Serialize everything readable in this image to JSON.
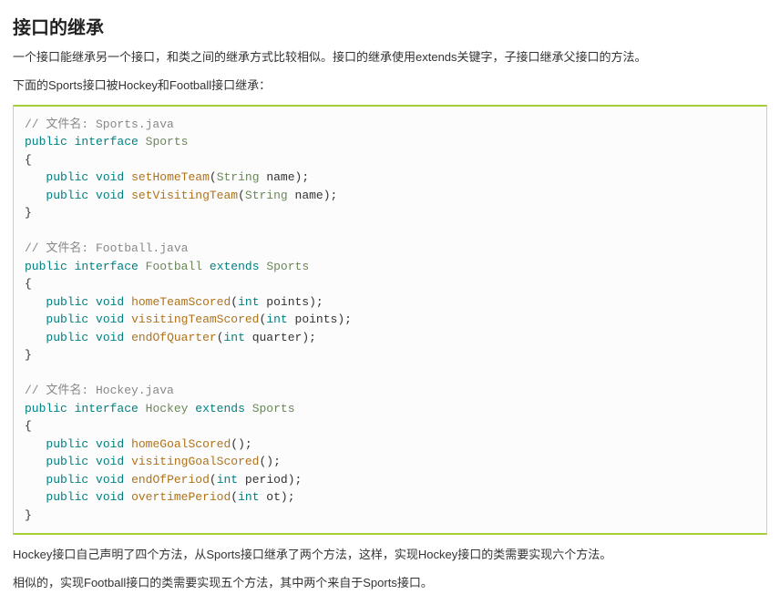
{
  "heading": "接口的继承",
  "para1": "一个接口能继承另一个接口，和类之间的继承方式比较相似。接口的继承使用extends关键字，子接口继承父接口的方法。",
  "para2": "下面的Sports接口被Hockey和Football接口继承：",
  "para3": "Hockey接口自己声明了四个方法，从Sports接口继承了两个方法，这样，实现Hockey接口的类需要实现六个方法。",
  "para4": "相似的，实现Football接口的类需要实现五个方法，其中两个来自于Sports接口。",
  "code": {
    "lines": [
      {
        "seg": [
          {
            "c": "com",
            "t": "// 文件名: Sports.java"
          }
        ]
      },
      {
        "seg": [
          {
            "c": "kw",
            "t": "public"
          },
          {
            "c": "pun",
            "t": " "
          },
          {
            "c": "kw",
            "t": "interface"
          },
          {
            "c": "pun",
            "t": " "
          },
          {
            "c": "typ",
            "t": "Sports"
          }
        ]
      },
      {
        "seg": [
          {
            "c": "pun",
            "t": "{"
          }
        ]
      },
      {
        "seg": [
          {
            "c": "pun",
            "t": "   "
          },
          {
            "c": "kw",
            "t": "public"
          },
          {
            "c": "pun",
            "t": " "
          },
          {
            "c": "kw",
            "t": "void"
          },
          {
            "c": "pun",
            "t": " "
          },
          {
            "c": "fn",
            "t": "setHomeTeam"
          },
          {
            "c": "pun",
            "t": "("
          },
          {
            "c": "typ",
            "t": "String"
          },
          {
            "c": "pun",
            "t": " name);"
          }
        ]
      },
      {
        "seg": [
          {
            "c": "pun",
            "t": "   "
          },
          {
            "c": "kw",
            "t": "public"
          },
          {
            "c": "pun",
            "t": " "
          },
          {
            "c": "kw",
            "t": "void"
          },
          {
            "c": "pun",
            "t": " "
          },
          {
            "c": "fn",
            "t": "setVisitingTeam"
          },
          {
            "c": "pun",
            "t": "("
          },
          {
            "c": "typ",
            "t": "String"
          },
          {
            "c": "pun",
            "t": " name);"
          }
        ]
      },
      {
        "seg": [
          {
            "c": "pun",
            "t": "}"
          }
        ]
      },
      {
        "seg": [
          {
            "c": "pun",
            "t": " "
          }
        ]
      },
      {
        "seg": [
          {
            "c": "com",
            "t": "// 文件名: Football.java"
          }
        ]
      },
      {
        "seg": [
          {
            "c": "kw",
            "t": "public"
          },
          {
            "c": "pun",
            "t": " "
          },
          {
            "c": "kw",
            "t": "interface"
          },
          {
            "c": "pun",
            "t": " "
          },
          {
            "c": "typ",
            "t": "Football"
          },
          {
            "c": "pun",
            "t": " "
          },
          {
            "c": "kw",
            "t": "extends"
          },
          {
            "c": "pun",
            "t": " "
          },
          {
            "c": "typ",
            "t": "Sports"
          }
        ]
      },
      {
        "seg": [
          {
            "c": "pun",
            "t": "{"
          }
        ]
      },
      {
        "seg": [
          {
            "c": "pun",
            "t": "   "
          },
          {
            "c": "kw",
            "t": "public"
          },
          {
            "c": "pun",
            "t": " "
          },
          {
            "c": "kw",
            "t": "void"
          },
          {
            "c": "pun",
            "t": " "
          },
          {
            "c": "fn",
            "t": "homeTeamScored"
          },
          {
            "c": "pun",
            "t": "("
          },
          {
            "c": "kw",
            "t": "int"
          },
          {
            "c": "pun",
            "t": " points);"
          }
        ]
      },
      {
        "seg": [
          {
            "c": "pun",
            "t": "   "
          },
          {
            "c": "kw",
            "t": "public"
          },
          {
            "c": "pun",
            "t": " "
          },
          {
            "c": "kw",
            "t": "void"
          },
          {
            "c": "pun",
            "t": " "
          },
          {
            "c": "fn",
            "t": "visitingTeamScored"
          },
          {
            "c": "pun",
            "t": "("
          },
          {
            "c": "kw",
            "t": "int"
          },
          {
            "c": "pun",
            "t": " points);"
          }
        ]
      },
      {
        "seg": [
          {
            "c": "pun",
            "t": "   "
          },
          {
            "c": "kw",
            "t": "public"
          },
          {
            "c": "pun",
            "t": " "
          },
          {
            "c": "kw",
            "t": "void"
          },
          {
            "c": "pun",
            "t": " "
          },
          {
            "c": "fn",
            "t": "endOfQuarter"
          },
          {
            "c": "pun",
            "t": "("
          },
          {
            "c": "kw",
            "t": "int"
          },
          {
            "c": "pun",
            "t": " quarter);"
          }
        ]
      },
      {
        "seg": [
          {
            "c": "pun",
            "t": "}"
          }
        ]
      },
      {
        "seg": [
          {
            "c": "pun",
            "t": " "
          }
        ]
      },
      {
        "seg": [
          {
            "c": "com",
            "t": "// 文件名: Hockey.java"
          }
        ]
      },
      {
        "seg": [
          {
            "c": "kw",
            "t": "public"
          },
          {
            "c": "pun",
            "t": " "
          },
          {
            "c": "kw",
            "t": "interface"
          },
          {
            "c": "pun",
            "t": " "
          },
          {
            "c": "typ",
            "t": "Hockey"
          },
          {
            "c": "pun",
            "t": " "
          },
          {
            "c": "kw",
            "t": "extends"
          },
          {
            "c": "pun",
            "t": " "
          },
          {
            "c": "typ",
            "t": "Sports"
          }
        ]
      },
      {
        "seg": [
          {
            "c": "pun",
            "t": "{"
          }
        ]
      },
      {
        "seg": [
          {
            "c": "pun",
            "t": "   "
          },
          {
            "c": "kw",
            "t": "public"
          },
          {
            "c": "pun",
            "t": " "
          },
          {
            "c": "kw",
            "t": "void"
          },
          {
            "c": "pun",
            "t": " "
          },
          {
            "c": "fn",
            "t": "homeGoalScored"
          },
          {
            "c": "pun",
            "t": "();"
          }
        ]
      },
      {
        "seg": [
          {
            "c": "pun",
            "t": "   "
          },
          {
            "c": "kw",
            "t": "public"
          },
          {
            "c": "pun",
            "t": " "
          },
          {
            "c": "kw",
            "t": "void"
          },
          {
            "c": "pun",
            "t": " "
          },
          {
            "c": "fn",
            "t": "visitingGoalScored"
          },
          {
            "c": "pun",
            "t": "();"
          }
        ]
      },
      {
        "seg": [
          {
            "c": "pun",
            "t": "   "
          },
          {
            "c": "kw",
            "t": "public"
          },
          {
            "c": "pun",
            "t": " "
          },
          {
            "c": "kw",
            "t": "void"
          },
          {
            "c": "pun",
            "t": " "
          },
          {
            "c": "fn",
            "t": "endOfPeriod"
          },
          {
            "c": "pun",
            "t": "("
          },
          {
            "c": "kw",
            "t": "int"
          },
          {
            "c": "pun",
            "t": " period);"
          }
        ]
      },
      {
        "seg": [
          {
            "c": "pun",
            "t": "   "
          },
          {
            "c": "kw",
            "t": "public"
          },
          {
            "c": "pun",
            "t": " "
          },
          {
            "c": "kw",
            "t": "void"
          },
          {
            "c": "pun",
            "t": " "
          },
          {
            "c": "fn",
            "t": "overtimePeriod"
          },
          {
            "c": "pun",
            "t": "("
          },
          {
            "c": "kw",
            "t": "int"
          },
          {
            "c": "pun",
            "t": " ot);"
          }
        ]
      },
      {
        "seg": [
          {
            "c": "pun",
            "t": "}"
          }
        ]
      }
    ]
  }
}
